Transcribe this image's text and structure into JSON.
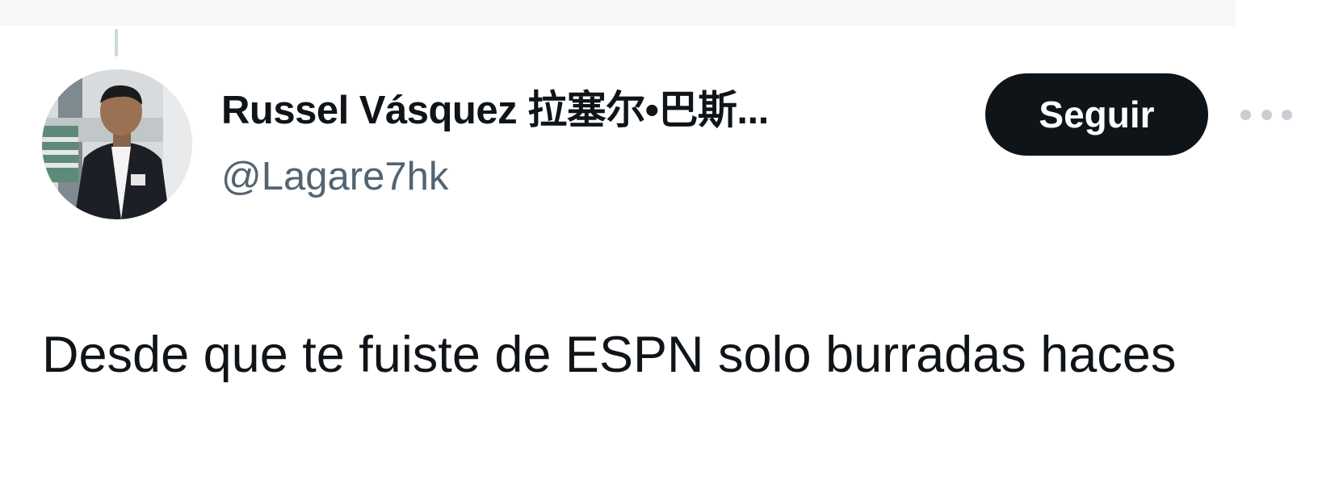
{
  "author": {
    "display_name": "Russel Vásquez 拉塞尔•巴斯...",
    "handle": "@Lagare7hk"
  },
  "actions": {
    "follow_label": "Seguir",
    "more_icon": "more-horizontal-icon"
  },
  "tweet": {
    "text": "Desde que te fuiste de ESPN solo burradas haces"
  },
  "colors": {
    "text_primary": "#0f1419",
    "text_secondary": "#536471",
    "button_bg": "#0f1419",
    "button_text": "#ffffff"
  }
}
